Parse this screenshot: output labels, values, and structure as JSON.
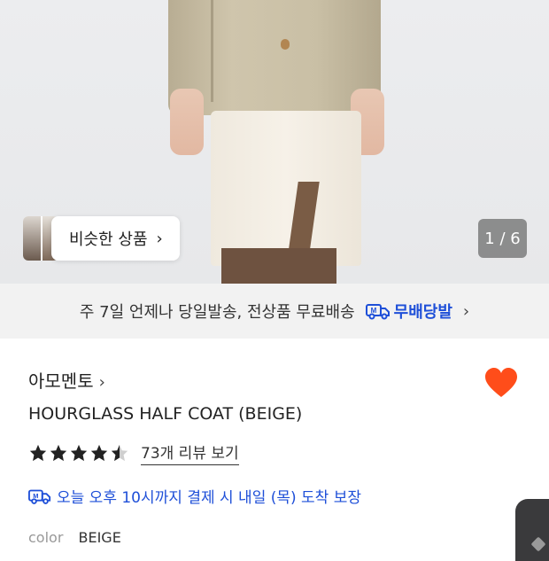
{
  "gallery": {
    "similar_label": "비슷한 상품",
    "counter": "1 / 6"
  },
  "shipping": {
    "text": "주 7일 언제나 당일발송, 전상품 무료배송",
    "brand": "무배당발"
  },
  "product": {
    "brand": "아모멘토",
    "title": "HOURGLASS HALF COAT (BEIGE)",
    "rating": 4.5,
    "review_link": "73개 리뷰 보기",
    "delivery_text": "오늘 오후 10시까지 결제 시 내일 (목) 도착 보장",
    "color_label": "color",
    "color_value": "BEIGE",
    "wishlisted": true
  },
  "colors": {
    "accent_blue": "#1e4fd8",
    "heart": "#ff4d1a"
  }
}
